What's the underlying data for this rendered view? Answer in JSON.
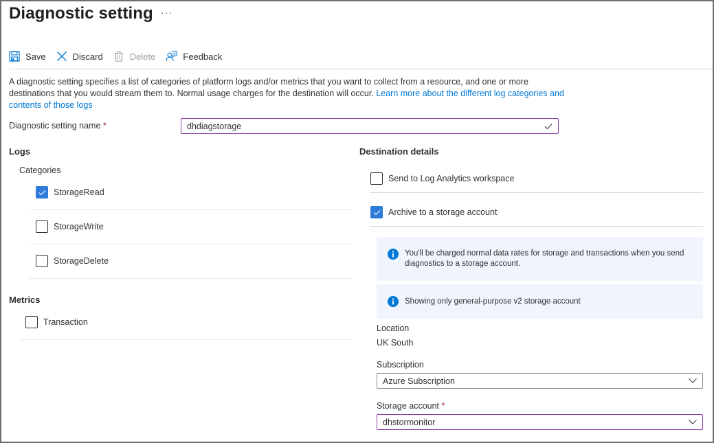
{
  "header": {
    "title": "Diagnostic setting",
    "more_label": "···"
  },
  "toolbar": {
    "save_label": "Save",
    "discard_label": "Discard",
    "delete_label": "Delete",
    "feedback_label": "Feedback"
  },
  "description": {
    "text": "A diagnostic setting specifies a list of categories of platform logs and/or metrics that you want to collect from a resource, and one or more destinations that you would stream them to. Normal usage charges for the destination will occur. ",
    "link_text": "Learn more about the different log categories and contents of those logs"
  },
  "setting_name": {
    "label": "Diagnostic setting name",
    "required_mark": "*",
    "value": "dhdiagstorage"
  },
  "logs": {
    "heading": "Logs",
    "categories_label": "Categories",
    "items": [
      {
        "label": "StorageRead",
        "checked": true
      },
      {
        "label": "StorageWrite",
        "checked": false
      },
      {
        "label": "StorageDelete",
        "checked": false
      }
    ]
  },
  "metrics": {
    "heading": "Metrics",
    "items": [
      {
        "label": "Transaction",
        "checked": false
      }
    ]
  },
  "destination": {
    "heading": "Destination details",
    "options": [
      {
        "label": "Send to Log Analytics workspace",
        "checked": false
      },
      {
        "label": "Archive to a storage account",
        "checked": true
      }
    ],
    "info_charges": "You'll be charged normal data rates for storage and transactions when you send diagnostics to a storage account.",
    "info_gpv2": "Showing only general-purpose v2 storage account",
    "location_label": "Location",
    "location_value": "UK South",
    "subscription_label": "Subscription",
    "subscription_value": "Azure Subscription",
    "storage_label": "Storage account",
    "storage_required_mark": "*",
    "storage_value": "dhstormonitor"
  },
  "colors": {
    "accent": "#0078d4",
    "checkbox_checked": "#2f7bd9",
    "focus_border": "#8a3fa6",
    "info_bg": "#eff4fd",
    "required": "#a4262c"
  }
}
